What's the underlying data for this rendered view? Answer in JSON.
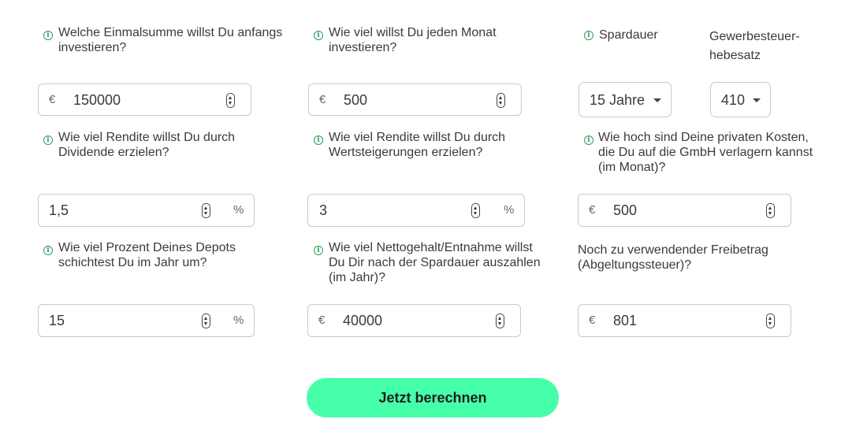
{
  "fields": {
    "einmalsumme": {
      "label": "Welche Einmalsumme willst Du anfangs investieren?",
      "currency": "€",
      "value": "150000"
    },
    "monatlich": {
      "label": "Wie viel willst Du jeden Monat investieren?",
      "currency": "€",
      "value": "500"
    },
    "spardauer": {
      "label": "Spardauer",
      "value": "15 Jahre"
    },
    "hebesatz": {
      "label": "Gewerbesteuer-hebesatz",
      "value": "410"
    },
    "dividende": {
      "label": "Wie viel Rendite willst Du durch Dividende erzielen?",
      "value": "1,5",
      "unit": "%"
    },
    "wertsteigerung": {
      "label": "Wie viel Rendite willst Du durch Wertsteigerungen erzielen?",
      "value": "3",
      "unit": "%"
    },
    "private_kosten": {
      "label": "Wie hoch sind Deine privaten Kosten, die Du auf die GmbH verlagern kannst (im Monat)?",
      "currency": "€",
      "value": "500"
    },
    "umschichtung": {
      "label": "Wie viel Prozent Deines Depots schichtest Du im Jahr um?",
      "value": "15",
      "unit": "%"
    },
    "nettogehalt": {
      "label": "Wie viel Nettogehalt/Entnahme willst Du Dir nach der Spardauer auszahlen (im Jahr)?",
      "currency": "€",
      "value": "40000"
    },
    "freibetrag": {
      "label": "Noch zu verwendender Freibetrag (Abgeltungssteuer)?",
      "currency": "€",
      "value": "801"
    }
  },
  "cta": {
    "label": "Jetzt berechnen"
  },
  "colors": {
    "accent": "#46ffa9",
    "info_icon": "#2f9e5b",
    "border": "#c9c9c9"
  }
}
